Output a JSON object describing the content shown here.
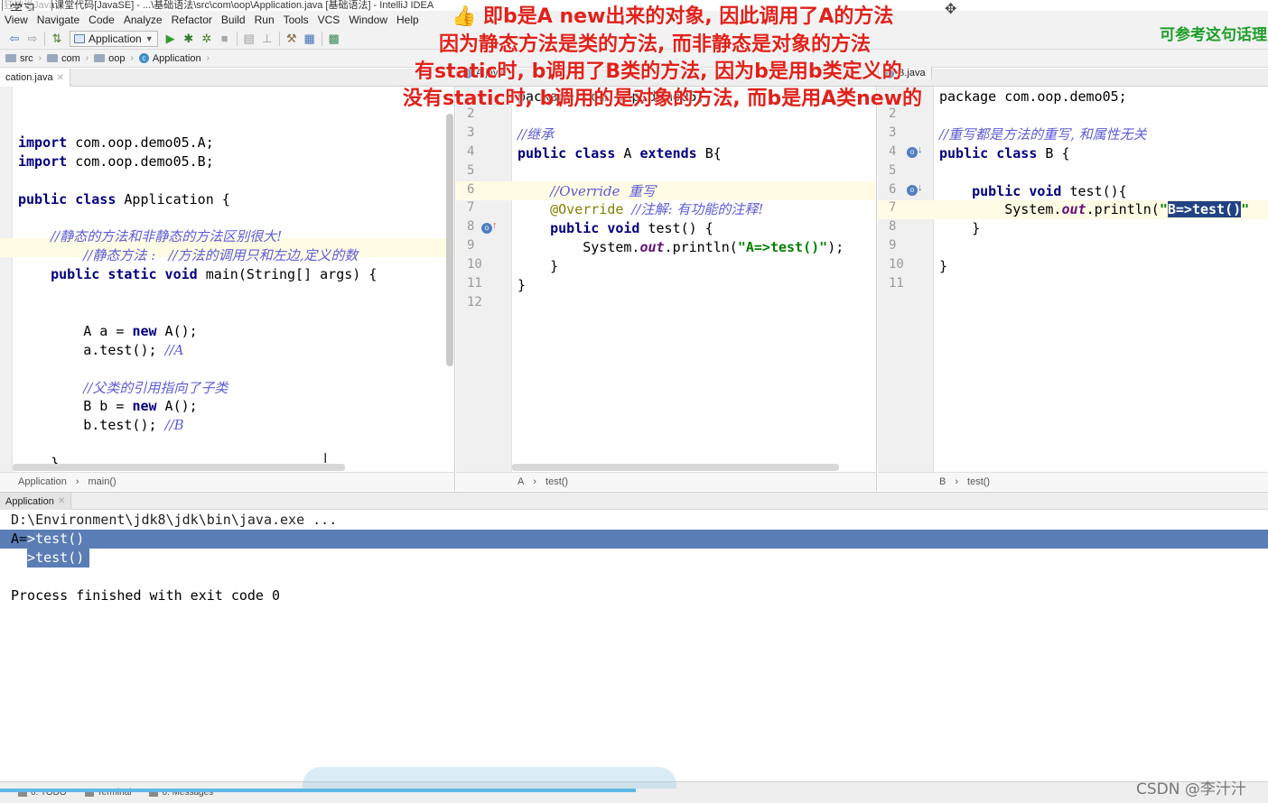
{
  "window": {
    "title": "狂神说Java课堂代码[JavaSE] - ...\\基础语法\\src\\com\\oop\\Application.java [基础语法] - IntelliJ IDEA",
    "logo_text": "学习"
  },
  "menu": [
    "View",
    "Navigate",
    "Code",
    "Analyze",
    "Refactor",
    "Build",
    "Run",
    "Tools",
    "VCS",
    "Window",
    "Help"
  ],
  "toolbar": {
    "run_config": "Application",
    "icons": [
      "back-icon",
      "forward-icon",
      "make-icon",
      "run-icon",
      "debug-icon",
      "coverage-icon",
      "stop-icon",
      "build-icon",
      "structure-icon",
      "settings-icon",
      "sdk-icon",
      "vcs-icon"
    ]
  },
  "breadcrumb": [
    "src",
    "com",
    "oop",
    "Application"
  ],
  "tabs": {
    "left": "cation.java",
    "middle": "A.java",
    "right": "B.java"
  },
  "editor_left": {
    "lines": [
      {
        "row": 2,
        "html": "<span class=\"kw\">import</span> com.oop.demo05.A;"
      },
      {
        "row": 3,
        "html": "<span class=\"kw\">import</span> com.oop.demo05.B;"
      },
      {
        "row": 5,
        "html": "<span class=\"kw\">public class</span> Application {"
      },
      {
        "row": 7,
        "html": "    <span class=\"cmt\">//静态的方法和非静态的方法区别很大!</span>"
      },
      {
        "row": 8,
        "html": "        <span class=\"cmt\">//静态方法 :   //方法的调用只和左边,定义的数</span>"
      },
      {
        "row": 9,
        "html": "    <span class=\"kw\">public static void</span> main(String[] args) {"
      },
      {
        "row": 12,
        "html": "        A a = <span class=\"kw\">new</span> A();"
      },
      {
        "row": 13,
        "html": "        a.test(); <span class=\"cmt\">//A</span>"
      },
      {
        "row": 15,
        "html": "        <span class=\"cmt\">//父类的引用指向了子类</span>"
      },
      {
        "row": 16,
        "html": "        B b = <span class=\"kw\">new</span> A();"
      },
      {
        "row": 17,
        "html": "        b.test(); <span class=\"cmt\">//B</span>"
      },
      {
        "row": 19,
        "html": "    }"
      }
    ],
    "crumb": [
      "Application",
      "main()"
    ]
  },
  "editor_mid": {
    "line_numbers": [
      "2",
      "3",
      "4",
      "5",
      "6",
      "7",
      "8",
      "9",
      "10",
      "11",
      "12"
    ],
    "lines": [
      {
        "row": 0,
        "html": "package com.oop.demo05;"
      },
      {
        "row": 2,
        "html": "<span class=\"cmt\">//继承</span>"
      },
      {
        "row": 3,
        "html": "<span class=\"kw\">public class</span> A <span class=\"kw\">extends</span> B{"
      },
      {
        "row": 5,
        "html": "    <span class=\"cmt\">//Override  重写</span>"
      },
      {
        "row": 6,
        "html": "    <span class=\"ann\">@Override</span> <span class=\"cmt\">//注解: 有功能的注释!</span>"
      },
      {
        "row": 7,
        "html": "    <span class=\"kw\">public void</span> test() {"
      },
      {
        "row": 8,
        "html": "        System.<span class=\"ital\">out</span>.println(<span class=\"str\">\"A=&gt;test()\"</span>);"
      },
      {
        "row": 9,
        "html": "    }"
      },
      {
        "row": 10,
        "html": "}"
      }
    ],
    "crumb": [
      "A",
      "test()"
    ]
  },
  "editor_right": {
    "line_numbers": [
      "2",
      "3",
      "4",
      "5",
      "6",
      "7",
      "8",
      "9",
      "10",
      "11"
    ],
    "lines": [
      {
        "row": 0,
        "html": "package com.oop.demo05;"
      },
      {
        "row": 2,
        "html": "<span class=\"cmt\">//重写都是方法的重写, 和属性无关</span>"
      },
      {
        "row": 3,
        "html": "<span class=\"kw\">public class</span> B {"
      },
      {
        "row": 5,
        "html": "    <span class=\"kw\">public void</span> test(){"
      },
      {
        "row": 6,
        "html": "        System.<span class=\"ital\">out</span>.println(<span class=\"str\">\"<span class=\"sel\">B=&gt;test()</span>\"</span>"
      },
      {
        "row": 7,
        "html": "    }"
      },
      {
        "row": 9,
        "html": "}"
      }
    ],
    "crumb": [
      "B",
      "test()"
    ]
  },
  "run": {
    "tab_label": "Application",
    "console": [
      "D:\\Environment\\jdk8\\jdk\\bin\\java.exe ...",
      "A=>test()",
      "A=>test()",
      "",
      "Process finished with exit code 0"
    ],
    "selection_color": "#5b7db5"
  },
  "bottom_tools": [
    "6: TODO",
    "Terminal",
    "0: Messages"
  ],
  "annotations": {
    "line1": "👍 即b是A new出来的对象, 因此调用了A的方法",
    "line2": "因为静态方法是类的方法, 而非静态是对象的方法",
    "line3": "有static时, b调用了B类的方法, 因为b是用b类定义的",
    "line4": "没有static时, b调用的是对象的方法, 而b是用A类new的",
    "side_note": "可参考这句话理",
    "color": "#e0221b"
  },
  "watermark": "CSDN @李汁汁"
}
